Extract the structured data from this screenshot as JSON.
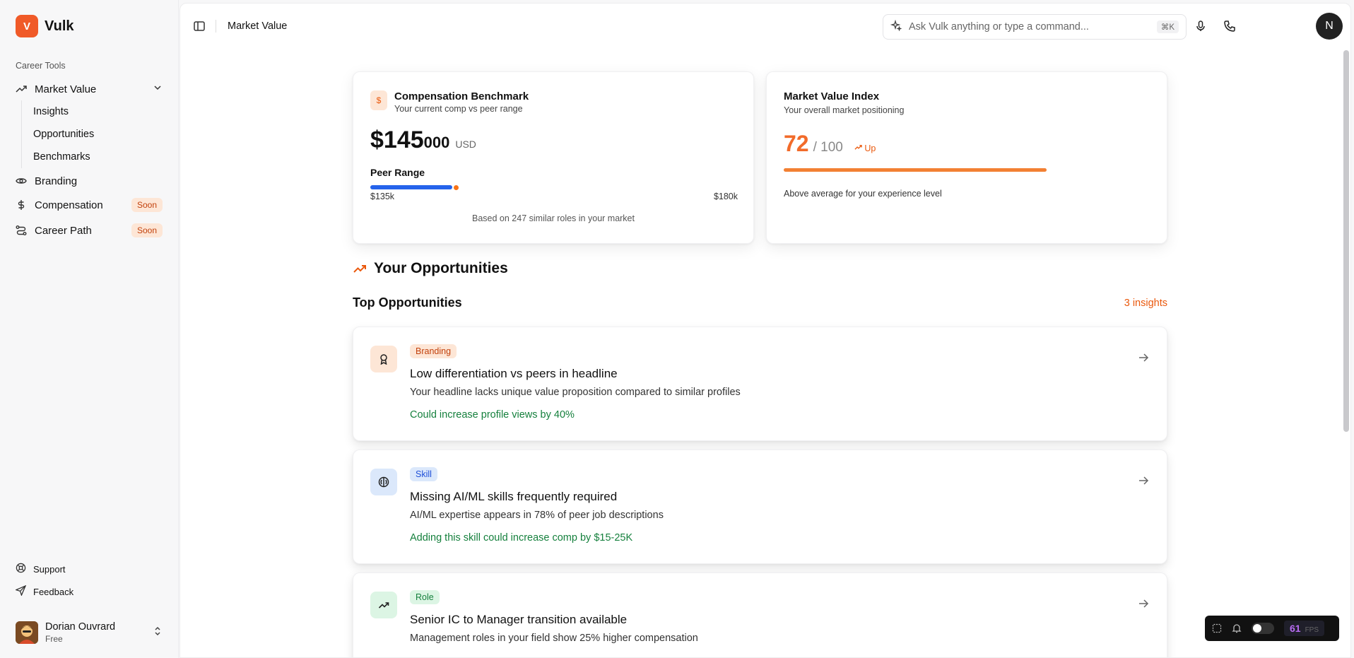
{
  "brand": {
    "logo_letter": "V",
    "name": "Vulk"
  },
  "sidebar": {
    "section_label": "Career Tools",
    "market_value": {
      "label": "Market Value",
      "sub_items": [
        "Insights",
        "Opportunities",
        "Benchmarks"
      ]
    },
    "items": [
      {
        "label": "Branding",
        "icon": "eye-icon",
        "badge": ""
      },
      {
        "label": "Compensation",
        "icon": "dollar-icon",
        "badge": "Soon"
      },
      {
        "label": "Career Path",
        "icon": "route-icon",
        "badge": "Soon"
      }
    ],
    "footer": {
      "support": "Support",
      "feedback": "Feedback"
    },
    "user": {
      "name": "Dorian Ouvrard",
      "plan": "Free"
    }
  },
  "topbar": {
    "breadcrumb": "Market Value",
    "command_placeholder": "Ask Vulk anything or type a command...",
    "shortcut": "⌘K",
    "avatar_letter": "N"
  },
  "compensation": {
    "title": "Compensation Benchmark",
    "subtitle": "Your current comp vs peer range",
    "icon": "$",
    "amount_main": "$145",
    "amount_small": "000",
    "currency": "USD",
    "peer_label": "Peer Range",
    "range_min": "$135k",
    "range_max": "$180k",
    "note": "Based on 247 similar roles in your market"
  },
  "market_index": {
    "title": "Market Value Index",
    "subtitle": "Your overall market positioning",
    "score": "72",
    "out_of": "/ 100",
    "trend": "Up",
    "fraction": 0.72,
    "note": "Above average for your experience level"
  },
  "opportunities": {
    "section_title": "Your Opportunities",
    "list_title": "Top Opportunities",
    "count_label": "3 insights",
    "items": [
      {
        "tag": "Branding",
        "tag_bg": "#fde6d6",
        "tag_color": "#c2410c",
        "icon_bg": "#fde6d6",
        "icon": "award-icon",
        "title": "Low differentiation vs peers in headline",
        "desc": "Your headline lacks unique value proposition compared to similar profiles",
        "impact": "Could increase profile views by 40%"
      },
      {
        "tag": "Skill",
        "tag_bg": "#dbe8fb",
        "tag_color": "#1d4ed8",
        "icon_bg": "#dbe8fb",
        "icon": "brain-icon",
        "title": "Missing AI/ML skills frequently required",
        "desc": "AI/ML expertise appears in 78% of peer job descriptions",
        "impact": "Adding this skill could increase comp by $15-25K"
      },
      {
        "tag": "Role",
        "tag_bg": "#dcf5e4",
        "tag_color": "#15803d",
        "icon_bg": "#dcf5e4",
        "icon": "trending-up-icon",
        "title": "Senior IC to Manager transition available",
        "desc": "Management roles in your field show 25% higher compensation",
        "impact": ""
      }
    ]
  },
  "devtools": {
    "fps": "61",
    "fps_label": "FPS"
  },
  "colors": {
    "accent": "#f05a28",
    "success": "#15803d",
    "peer_bar": "#2563eb"
  }
}
